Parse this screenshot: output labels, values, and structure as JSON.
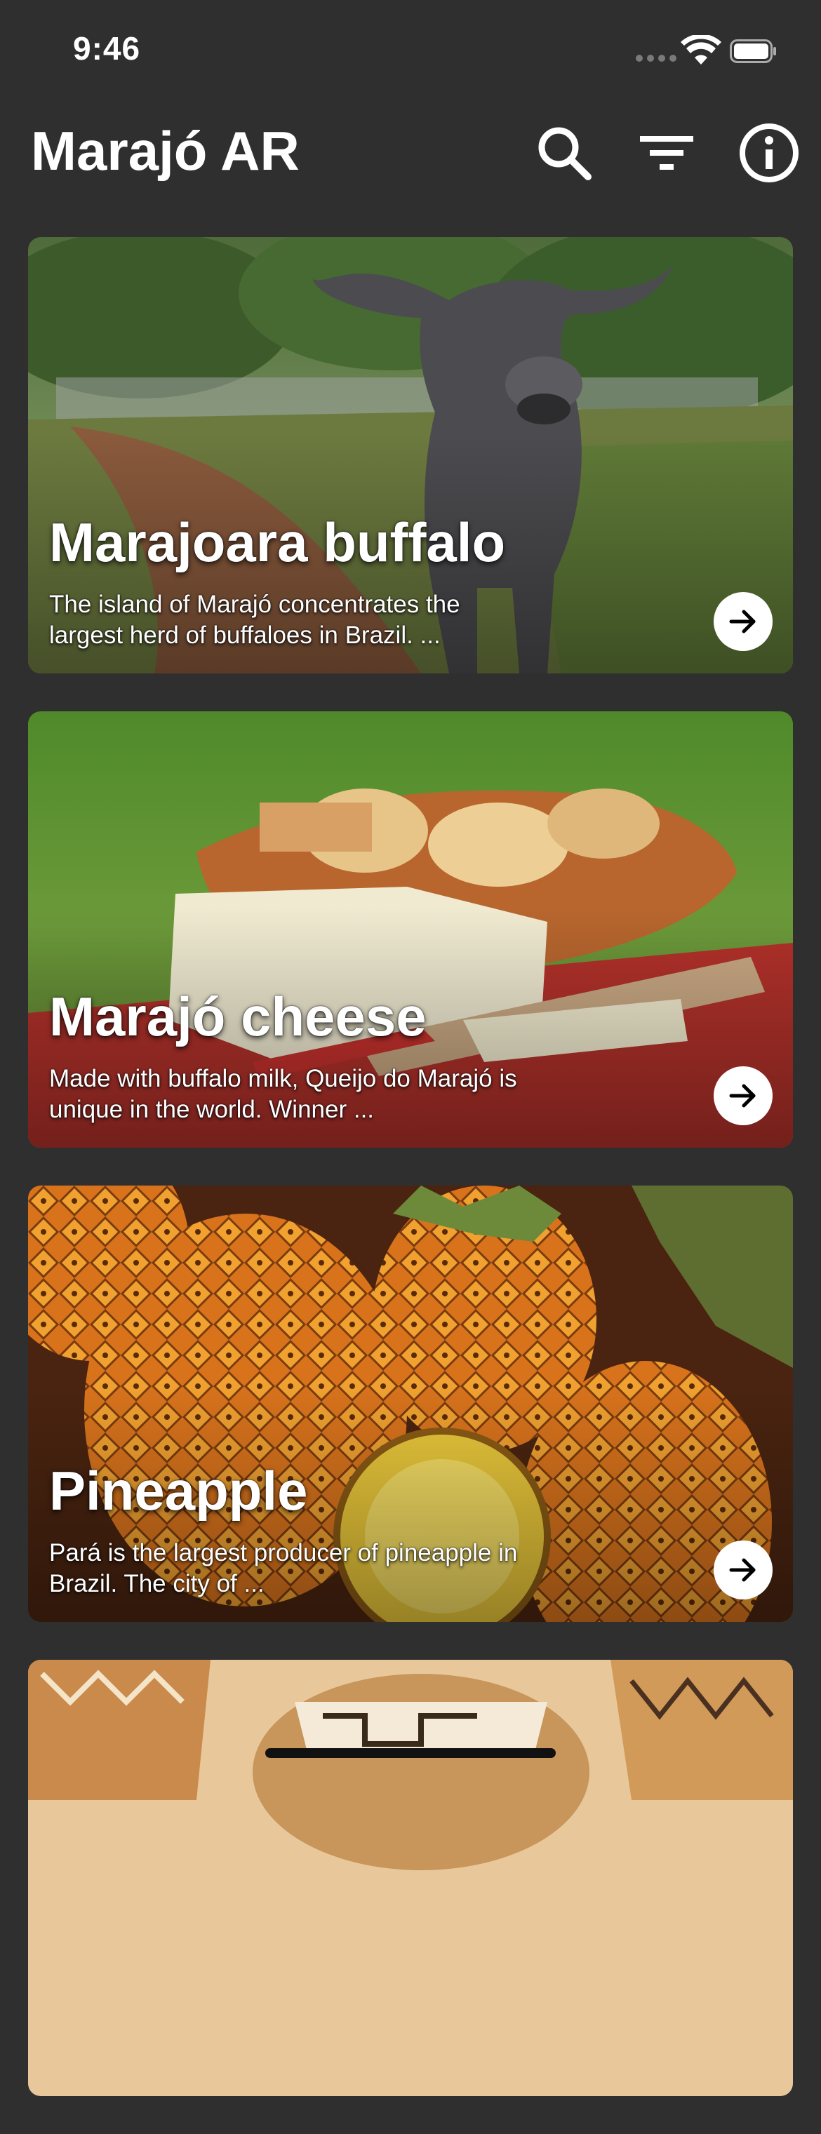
{
  "status_bar": {
    "time": "9:46"
  },
  "header": {
    "title": "Marajó AR"
  },
  "icons": {
    "search": "search-icon",
    "filter": "filter-icon",
    "info": "info-icon",
    "arrow": "arrow-right-icon"
  },
  "cards": [
    {
      "title": "Marajoara buffalo",
      "description": "The island of Marajó concentrates the largest herd of buffaloes in Brazil. ..."
    },
    {
      "title": "Marajó cheese",
      "description": "Made with buffalo milk, Queijo do Marajó is unique in the world. Winner ..."
    },
    {
      "title": "Pineapple",
      "description": "Pará is the largest producer of pineapple in Brazil. The city of ..."
    }
  ],
  "colors": {
    "background": "#2f2f2f",
    "text": "#ffffff"
  }
}
